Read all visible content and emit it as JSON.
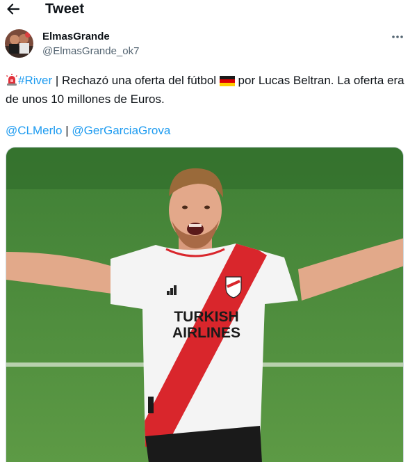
{
  "header": {
    "title": "Tweet",
    "back_icon": "arrow-left-icon"
  },
  "author": {
    "display_name": "ElmasGrande",
    "handle": "@ElmasGrande_ok7",
    "avatar_icon": "profile-photo"
  },
  "more_icon": "more-horizontal-icon",
  "tweet": {
    "siren_emoji": "police-light-emoji",
    "hashtag": "#River",
    "text_part1": " | Rechazó una oferta del fútbol ",
    "flag_emoji": "germany-flag-emoji",
    "text_part2": " por Lucas Beltran. La oferta era de unos 10 millones de Euros.",
    "mention1": "@CLMerlo",
    "separator": " | ",
    "mention2": "@GerGarciaGrova"
  },
  "media": {
    "description": "photo",
    "shirt_sponsor_line1": "TURKISH",
    "shirt_sponsor_line2": "AIRLINES",
    "colors": {
      "grass": "#4e8a3c",
      "shirt": "#f4f4f4",
      "sash": "#d9262c"
    }
  },
  "colors": {
    "link": "#1d9bf0",
    "text": "#0f1419",
    "muted": "#536471"
  }
}
